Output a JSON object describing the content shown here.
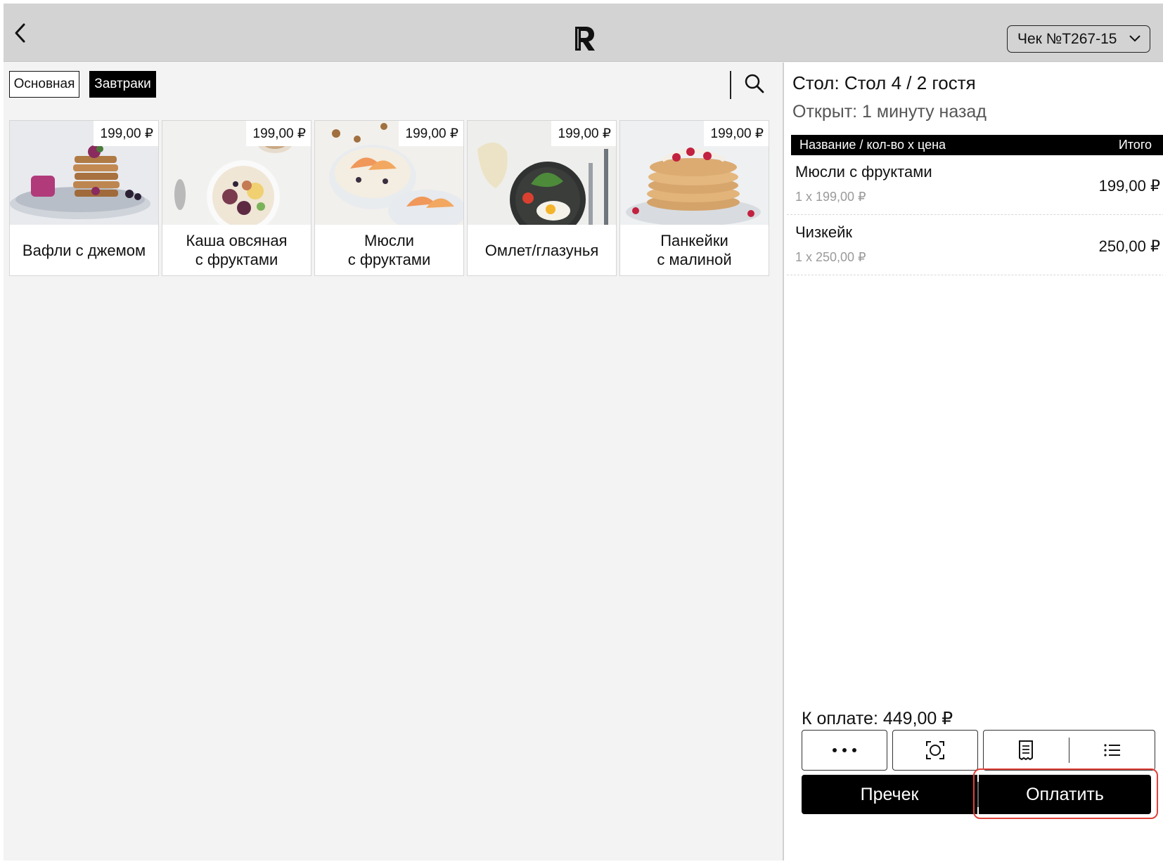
{
  "header": {
    "check_label": "Чек №T267-15",
    "logo_letter": "R"
  },
  "menu": {
    "tabs": [
      {
        "label": "Основная",
        "active": false
      },
      {
        "label": "Завтраки",
        "active": true
      }
    ],
    "products": [
      {
        "name": "Вафли с джемом",
        "price": "199,00 ₽",
        "image": "waffles-with-jam-photo"
      },
      {
        "name": "Каша овсяная\nс фруктами",
        "price": "199,00 ₽",
        "image": "oatmeal-with-fruits-photo"
      },
      {
        "name": "Мюсли\nс фруктами",
        "price": "199,00 ₽",
        "image": "muesli-with-fruits-photo"
      },
      {
        "name": "Омлет/глазунья",
        "price": "199,00 ₽",
        "image": "fried-eggs-photo"
      },
      {
        "name": "Панкейки\nс малиной",
        "price": "199,00 ₽",
        "image": "pancakes-with-raspberry-photo"
      }
    ]
  },
  "order": {
    "table": "Стол: Стол 4 / 2 гостя",
    "opened": "Открыт: 1 минуту назад",
    "columns": {
      "name": "Название / кол-во х цена",
      "total": "Итого"
    },
    "items": [
      {
        "name": "Мюсли с фруктами",
        "qty": "1 х 199,00 ₽",
        "total": "199,00 ₽"
      },
      {
        "name": "Чизкейк",
        "qty": "1 х 250,00 ₽",
        "total": "250,00 ₽"
      }
    ],
    "to_pay": "К оплате: 449,00 ₽",
    "precheck_label": "Пречек",
    "pay_label": "Оплатить",
    "highlight_color": "#e0413a"
  },
  "icons": [
    "back-chevron-icon",
    "logo-icon",
    "chevron-down-icon",
    "search-icon",
    "more-dots-icon",
    "scan-icon",
    "receipt-icon",
    "list-icon"
  ]
}
